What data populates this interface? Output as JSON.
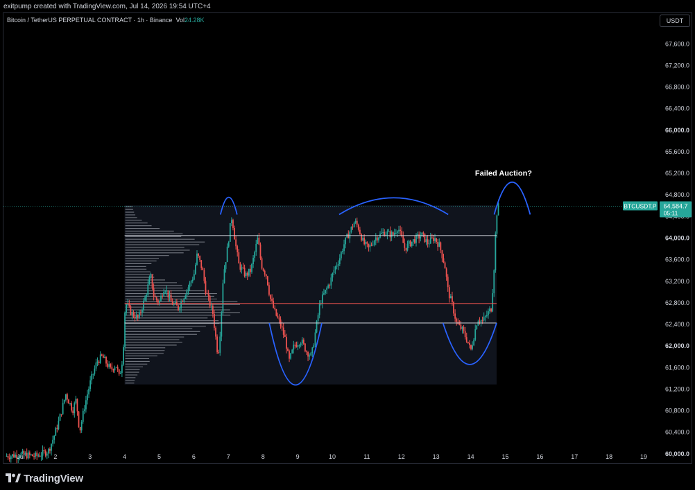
{
  "header": {
    "credit": "exitpump created with TradingView.com, Jul 14, 2026 19:54 UTC+4",
    "symbol_line": "Bitcoin / TetherUS PERPETUAL CONTRACT · 1h · Binance",
    "vol_label": "Vol",
    "vol_value": "24.28K",
    "currency_button": "USDT"
  },
  "footer": {
    "brand": "TradingView"
  },
  "colors": {
    "up": "#26a69a",
    "down": "#ef5350",
    "box": "#131722",
    "arc": "#2962ff",
    "level_line": "#d1d4dc",
    "poc_line": "#ef5350",
    "price_tag": "#26a69a"
  },
  "chart_data": {
    "type": "candlestick",
    "symbol": "BTCUSDT.P",
    "timeframe": "1h",
    "x_ticks": [
      "Jul",
      "2",
      "3",
      "4",
      "5",
      "6",
      "7",
      "8",
      "9",
      "10",
      "11",
      "12",
      "13",
      "14",
      "15",
      "16",
      "17",
      "18",
      "19"
    ],
    "y_ticks": [
      "67,600.0",
      "67,200.0",
      "66,800.0",
      "66,400.0",
      "66,000.0",
      "65,600.0",
      "65,200.0",
      "64,800.0",
      "64,400.0",
      "64,000.0",
      "63,600.0",
      "63,200.0",
      "62,800.0",
      "62,400.0",
      "62,000.0",
      "61,600.0",
      "61,200.0",
      "60,800.0",
      "60,400.0",
      "60,000.0"
    ],
    "y_tick_values": [
      67600,
      67200,
      66800,
      66400,
      66000,
      65600,
      65200,
      64800,
      64400,
      64000,
      63600,
      63200,
      62800,
      62400,
      62000,
      61600,
      61200,
      60800,
      60400,
      60000
    ],
    "ylim": [
      59850,
      67880
    ],
    "xlim": [
      0.5,
      19.4
    ],
    "last_price": 64584.7,
    "last_price_label": "64,584.7",
    "countdown": "05:11",
    "price_tag_label": "BTCUSDT.P",
    "levels": {
      "upper_line": 64040,
      "poc_line": 62780,
      "lower_line": 62420,
      "range_box": {
        "x": [
          4.0,
          14.75
        ],
        "y": [
          61280,
          64600
        ]
      }
    },
    "volume_profile_rows": [
      64600,
      61280
    ],
    "close_path": [
      [
        0.55,
        59950
      ],
      [
        1.0,
        59980
      ],
      [
        1.45,
        59950
      ],
      [
        1.8,
        60050
      ],
      [
        1.95,
        60300
      ],
      [
        2.1,
        60600
      ],
      [
        2.3,
        61100
      ],
      [
        2.5,
        60800
      ],
      [
        2.6,
        61000
      ],
      [
        2.7,
        60400
      ],
      [
        2.85,
        60900
      ],
      [
        3.0,
        61300
      ],
      [
        3.2,
        61700
      ],
      [
        3.35,
        61800
      ],
      [
        3.6,
        61550
      ],
      [
        3.75,
        61650
      ],
      [
        3.85,
        61400
      ],
      [
        3.95,
        61800
      ],
      [
        4.02,
        62800
      ],
      [
        4.2,
        62600
      ],
      [
        4.4,
        62500
      ],
      [
        4.6,
        62900
      ],
      [
        4.75,
        63300
      ],
      [
        4.85,
        62900
      ],
      [
        5.0,
        62800
      ],
      [
        5.15,
        63100
      ],
      [
        5.35,
        62800
      ],
      [
        5.55,
        62700
      ],
      [
        5.7,
        62900
      ],
      [
        5.85,
        63100
      ],
      [
        6.0,
        63300
      ],
      [
        6.1,
        63700
      ],
      [
        6.25,
        63400
      ],
      [
        6.35,
        63000
      ],
      [
        6.55,
        62600
      ],
      [
        6.7,
        61800
      ],
      [
        6.78,
        62400
      ],
      [
        6.85,
        63300
      ],
      [
        6.95,
        63700
      ],
      [
        7.05,
        64200
      ],
      [
        7.1,
        64400
      ],
      [
        7.2,
        63900
      ],
      [
        7.3,
        63500
      ],
      [
        7.5,
        63300
      ],
      [
        7.65,
        63400
      ],
      [
        7.75,
        63700
      ],
      [
        7.85,
        64000
      ],
      [
        7.95,
        63500
      ],
      [
        8.1,
        63300
      ],
      [
        8.2,
        62900
      ],
      [
        8.35,
        62600
      ],
      [
        8.5,
        62400
      ],
      [
        8.65,
        62100
      ],
      [
        8.75,
        61700
      ],
      [
        8.9,
        62000
      ],
      [
        9.1,
        62100
      ],
      [
        9.25,
        61900
      ],
      [
        9.4,
        61800
      ],
      [
        9.5,
        62200
      ],
      [
        9.65,
        62800
      ],
      [
        9.8,
        63000
      ],
      [
        9.95,
        63200
      ],
      [
        10.05,
        63400
      ],
      [
        10.2,
        63600
      ],
      [
        10.35,
        63900
      ],
      [
        10.5,
        64100
      ],
      [
        10.65,
        64300
      ],
      [
        10.75,
        64200
      ],
      [
        10.9,
        63900
      ],
      [
        11.05,
        63800
      ],
      [
        11.25,
        64000
      ],
      [
        11.5,
        64100
      ],
      [
        11.75,
        64050
      ],
      [
        11.9,
        64200
      ],
      [
        12.1,
        63800
      ],
      [
        12.25,
        63900
      ],
      [
        12.45,
        64000
      ],
      [
        12.6,
        64050
      ],
      [
        12.75,
        63900
      ],
      [
        12.95,
        64000
      ],
      [
        13.1,
        63850
      ],
      [
        13.25,
        63500
      ],
      [
        13.35,
        63000
      ],
      [
        13.45,
        62800
      ],
      [
        13.6,
        62400
      ],
      [
        13.75,
        62300
      ],
      [
        13.9,
        62100
      ],
      [
        14.0,
        61900
      ],
      [
        14.1,
        62200
      ],
      [
        14.2,
        62500
      ],
      [
        14.35,
        62450
      ],
      [
        14.5,
        62600
      ],
      [
        14.6,
        62700
      ],
      [
        14.68,
        63500
      ],
      [
        14.72,
        64100
      ],
      [
        14.76,
        64480
      ],
      [
        14.8,
        64584.7
      ]
    ],
    "annotations": [
      {
        "text": "Failed Auction?",
        "x": 14.95,
        "y": 65150
      },
      {
        "shape": "dome-arc",
        "x_range": [
          6.77,
          7.25
        ],
        "apex": 64750
      },
      {
        "shape": "dome-arc",
        "x_range": [
          10.2,
          13.35
        ],
        "apex": 64740
      },
      {
        "shape": "dome-arc",
        "x_range": [
          14.68,
          15.72
        ],
        "apex": 65030
      },
      {
        "shape": "bowl-arc",
        "x_range": [
          8.18,
          9.7
        ],
        "trough": 61270
      },
      {
        "shape": "bowl-arc",
        "x_range": [
          13.2,
          14.75
        ],
        "trough": 61650
      }
    ]
  }
}
